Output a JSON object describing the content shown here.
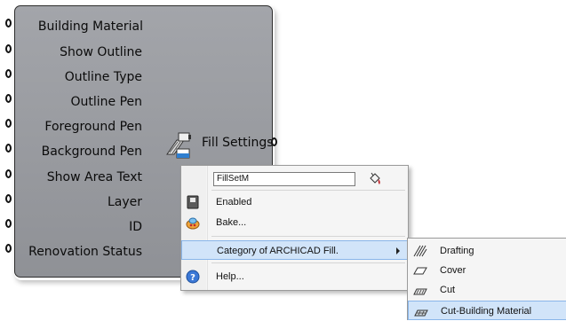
{
  "component": {
    "inputs": [
      {
        "label": "Building Material",
        "grip": "input-grip"
      },
      {
        "label": "Show Outline",
        "grip": "input-grip"
      },
      {
        "label": "Outline Type",
        "grip": "input-grip"
      },
      {
        "label": "Outline Pen",
        "grip": "input-grip"
      },
      {
        "label": "Foreground Pen",
        "grip": "input-grip"
      },
      {
        "label": "Background Pen",
        "grip": "input-grip"
      },
      {
        "label": "Show Area Text",
        "grip": "input-grip"
      },
      {
        "label": "Layer",
        "grip": "input-grip"
      },
      {
        "label": "ID",
        "grip": "input-grip"
      },
      {
        "label": "Renovation Status",
        "grip": "input-grip"
      }
    ],
    "name": "Fill Settings",
    "icon": "fill-settings-icon",
    "output_grip": "output-grip"
  },
  "context_menu": {
    "name_field_value": "FillSetM",
    "name_field_icon": "paint-bucket-icon",
    "items": {
      "enabled": {
        "label": "Enabled",
        "icon": "enabled-toggle-icon"
      },
      "bake": {
        "label": "Bake...",
        "icon": "bake-icon"
      },
      "category": {
        "label": "Category of ARCHICAD Fill.",
        "icon": "",
        "has_submenu": true
      },
      "help": {
        "label": "Help...",
        "icon": "help-icon"
      }
    }
  },
  "submenu": {
    "items": [
      {
        "label": "Drafting",
        "icon": "drafting-fill-icon"
      },
      {
        "label": "Cover",
        "icon": "cover-fill-icon"
      },
      {
        "label": "Cut",
        "icon": "cut-fill-icon"
      },
      {
        "label": "Cut-Building Material",
        "icon": "cut-building-material-icon",
        "highlighted": true
      }
    ]
  },
  "colors": {
    "component_body": "#9a9ca1",
    "menu_highlight": "#d1e4f9",
    "menu_highlight_border": "#89b6ea"
  }
}
